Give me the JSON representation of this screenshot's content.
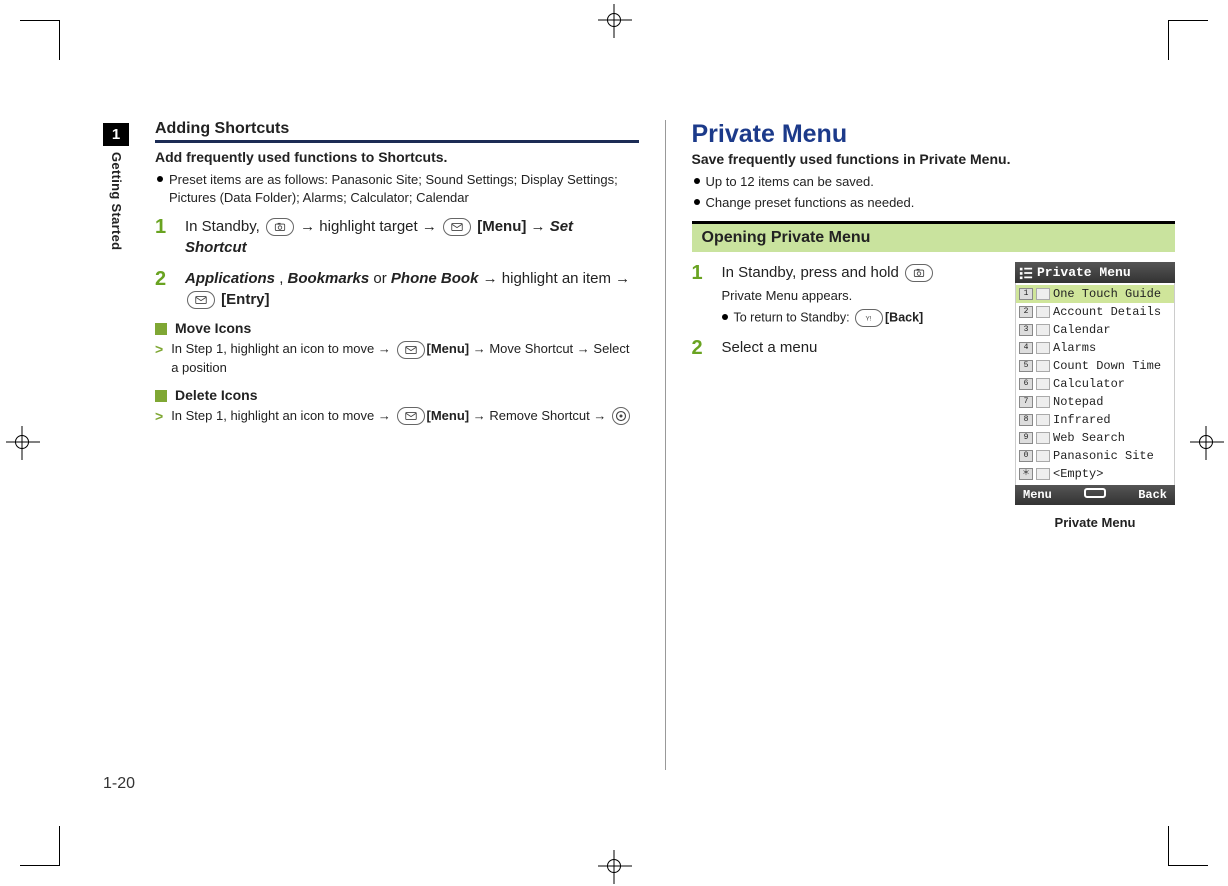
{
  "chapter": {
    "num": "1",
    "name": "Getting Started"
  },
  "page_number": "1-20",
  "left": {
    "heading": "Adding Shortcuts",
    "lead": "Add frequently used functions to Shortcuts.",
    "preset_bullet": "Preset items are as follows: Panasonic Site; Sound Settings; Display Settings; Pictures (Data Folder); Alarms; Calculator; Calendar",
    "step1_pre": "In Standby, ",
    "step1_mid": " → highlight target → ",
    "step1_menu": "[Menu]",
    "step1_end": " → ",
    "step1_action": "Set Shortcut",
    "step2_apps": "Applications",
    "step2_comma": ", ",
    "step2_bks": "Bookmarks",
    "step2_or": " or ",
    "step2_pb": "Phone Book",
    "step2_arrow": " → ",
    "step2_hl": "highlight an item → ",
    "step2_entry": "[Entry]",
    "move_heading": "Move Icons",
    "move_line_a": "In Step 1, highlight an icon to move → ",
    "move_menu": "[Menu]",
    "move_arrow2": " → ",
    "move_action": "Move Shortcut",
    "move_end": " → Select a position",
    "delete_heading": "Delete Icons",
    "delete_line_a": "In Step 1, highlight an icon to move → ",
    "delete_menu": "[Menu]",
    "delete_arrow2": " → ",
    "delete_action": "Remove Shortcut",
    "delete_end": " → "
  },
  "right": {
    "title": "Private Menu",
    "lead": "Save frequently used functions in Private Menu.",
    "bullet1": "Up to 12 items can be saved.",
    "bullet2": "Change preset functions as needed.",
    "subheading": "Opening Private Menu",
    "step1_text": "In Standby, press and hold ",
    "step1_sub": "Private Menu appears.",
    "step1_back_pre": "To return to Standby: ",
    "step1_back_btn": "[Back]",
    "step2_text": "Select a menu",
    "phone": {
      "title": "Private Menu",
      "items": [
        {
          "num": "1",
          "label": "One Touch Guide"
        },
        {
          "num": "2",
          "label": "Account Details"
        },
        {
          "num": "3",
          "label": "Calendar"
        },
        {
          "num": "4",
          "label": "Alarms"
        },
        {
          "num": "5",
          "label": "Count Down Time"
        },
        {
          "num": "6",
          "label": "Calculator"
        },
        {
          "num": "7",
          "label": "Notepad"
        },
        {
          "num": "8",
          "label": "Infrared"
        },
        {
          "num": "9",
          "label": "Web Search"
        },
        {
          "num": "0",
          "label": "Panasonic Site"
        },
        {
          "num": "＊",
          "label": "<Empty>"
        }
      ],
      "foot_left": "Menu",
      "foot_right": "Back",
      "caption": "Private Menu"
    }
  }
}
